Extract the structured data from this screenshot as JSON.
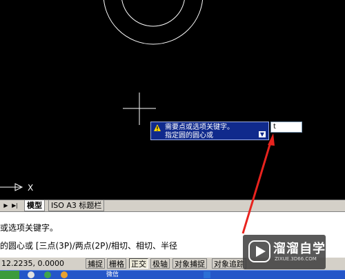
{
  "canvas": {
    "axis_label": "X"
  },
  "tooltip": {
    "line1": "需要点或选项关键字。",
    "line2": "指定圆的圆心或"
  },
  "dynamic_input": {
    "value": "t"
  },
  "layout_tabs": {
    "items": [
      {
        "label": "模型",
        "active": true
      },
      {
        "label": "ISO A3 标题栏",
        "active": false
      }
    ]
  },
  "command": {
    "line1": "或选项关键字。",
    "line2": "的圆心或 [三点(3P)/两点(2P)/相切、相切、半径"
  },
  "statusbar": {
    "coords": "12.2235, 0.0000",
    "buttons": [
      {
        "label": "捕捉",
        "on": false
      },
      {
        "label": "栅格",
        "on": false
      },
      {
        "label": "正交",
        "on": true
      },
      {
        "label": "极轴",
        "on": false
      },
      {
        "label": "对象捕捉",
        "on": false
      },
      {
        "label": "对象追踪",
        "on": false
      }
    ]
  },
  "taskbar": {
    "task1": "微信"
  },
  "watermark": {
    "name": "溜溜自学",
    "url": "ZIXUE.3D66.COM"
  },
  "colors": {
    "canvas_bg": "#000000",
    "tooltip_bg": "#102a8c",
    "arrow": "#e8231e",
    "taskbar": "#2456c8"
  }
}
